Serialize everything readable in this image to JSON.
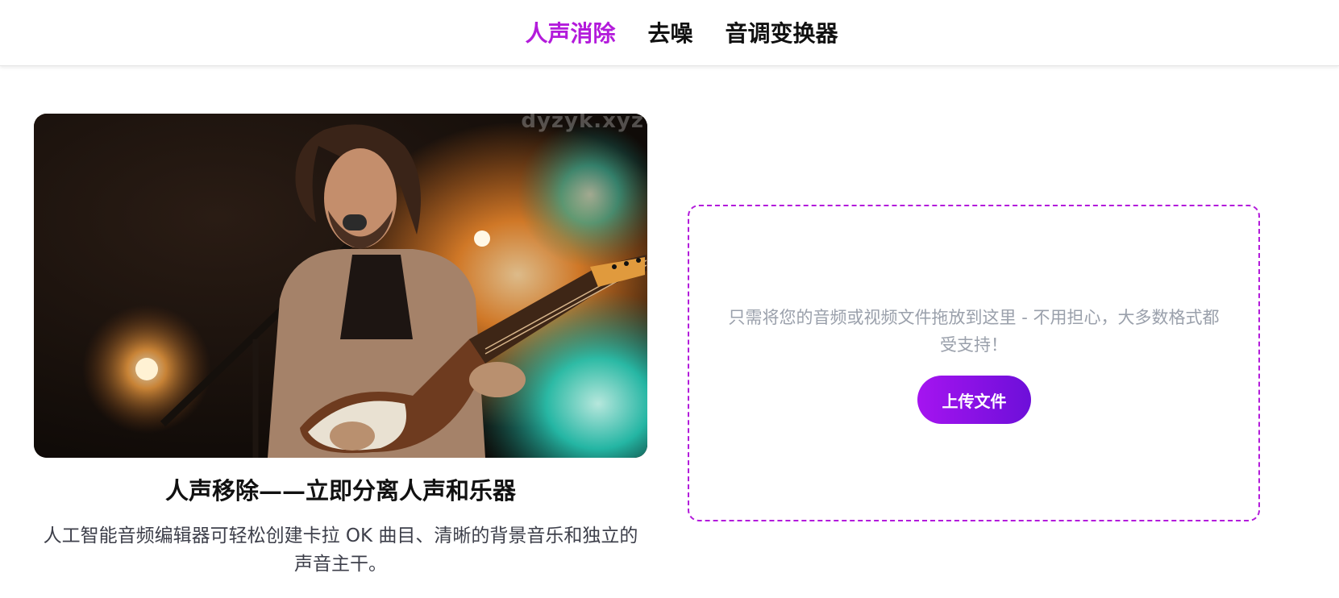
{
  "nav": {
    "items": [
      {
        "label": "人声消除",
        "active": true
      },
      {
        "label": "去噪",
        "active": false
      },
      {
        "label": "音调变换器",
        "active": false
      }
    ],
    "active_color": "#b31bdb"
  },
  "hero": {
    "image_alt": "singer-with-guitar-photo",
    "watermark": "dyzyk.xyz",
    "title": "人声移除——立即分离人声和乐器",
    "description": "人工智能音频编辑器可轻松创建卡拉 OK 曲目、清晰的背景音乐和独立的声音主干。"
  },
  "upload": {
    "hint": "只需将您的音频或视频文件拖放到这里 - 不用担心，大多数格式都受支持！",
    "button_label": "上传文件",
    "border_color": "#b31bdb",
    "button_colors": [
      "#a514f0",
      "#6d0fd9"
    ]
  }
}
